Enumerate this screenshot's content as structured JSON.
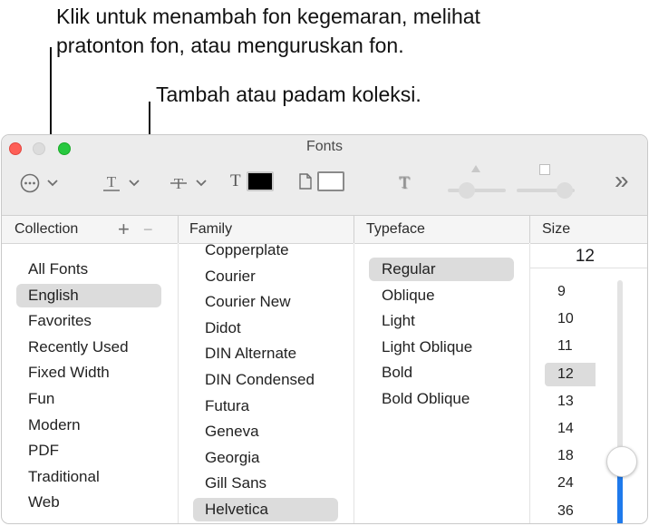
{
  "callouts": {
    "line1": "Klik untuk menambah fon kegemaran, melihat",
    "line2": "pratonton fon, atau menguruskan fon.",
    "line3": "Tambah atau padam koleksi."
  },
  "window": {
    "title": "Fonts"
  },
  "toolbar": {
    "action_icon": "ellipsis-circle-icon",
    "underline_icon": "underline-text-icon",
    "strikethrough_icon": "strikethrough-text-icon",
    "text_color_label": "T",
    "text_color": "#000000",
    "doc_color": "#ffffff",
    "shadow_label": "T",
    "overflow": "»"
  },
  "headers": {
    "collection": "Collection",
    "family": "Family",
    "typeface": "Typeface",
    "size": "Size",
    "add_symbol": "+",
    "remove_symbol": "−"
  },
  "collections": [
    "All Fonts",
    "English",
    "Favorites",
    "Recently Used",
    "Fixed Width",
    "Fun",
    "Modern",
    "PDF",
    "Traditional",
    "Web"
  ],
  "collections_selected": "English",
  "families": [
    "Copperplate",
    "Courier",
    "Courier New",
    "Didot",
    "DIN Alternate",
    "DIN Condensed",
    "Futura",
    "Geneva",
    "Georgia",
    "Gill Sans",
    "Helvetica"
  ],
  "families_selected": "Helvetica",
  "typefaces": [
    "Regular",
    "Oblique",
    "Light",
    "Light Oblique",
    "Bold",
    "Bold Oblique"
  ],
  "typefaces_selected": "Regular",
  "size": {
    "value": "12",
    "options": [
      "9",
      "10",
      "11",
      "12",
      "13",
      "14",
      "18",
      "24",
      "36"
    ],
    "selected": "12",
    "slider_level": 0.1
  }
}
